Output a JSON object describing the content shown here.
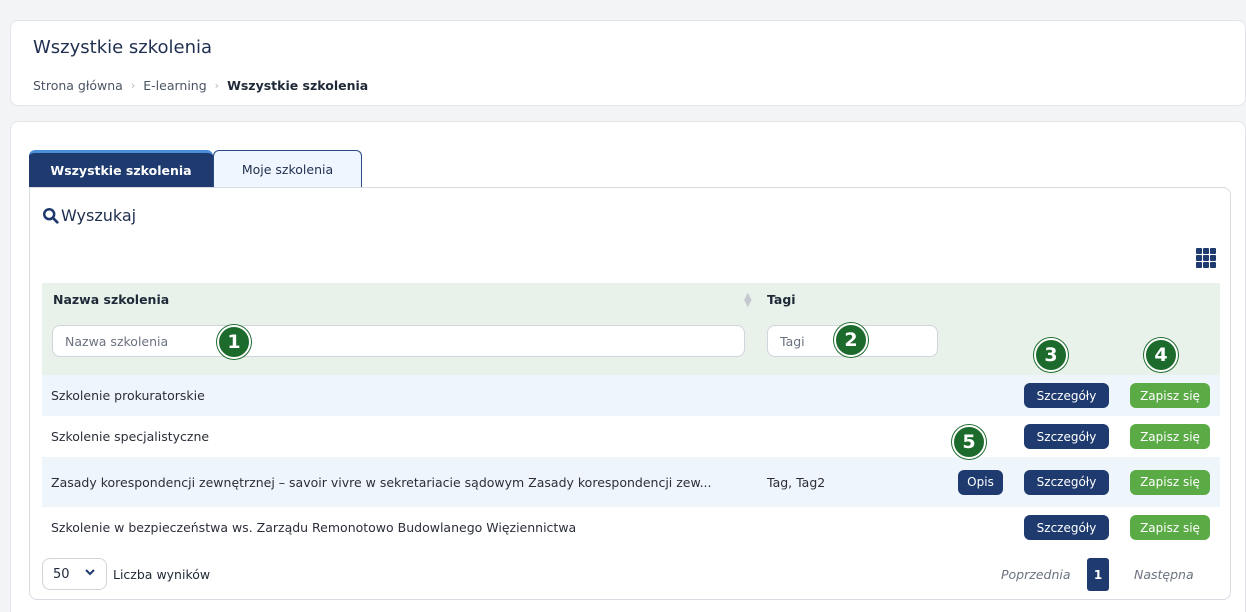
{
  "header": {
    "title": "Wszystkie szkolenia",
    "breadcrumb": {
      "home": "Strona główna",
      "section": "E-learning",
      "current": "Wszystkie szkolenia",
      "separator": "›"
    }
  },
  "tabs": [
    {
      "label": "Wszystkie szkolenia",
      "active": true
    },
    {
      "label": "Moje szkolenia",
      "active": false
    }
  ],
  "search": {
    "label": "Wyszukaj",
    "icon": "search-icon"
  },
  "columns_icon": "grid-icon",
  "table": {
    "columns": {
      "name": "Nazwa szkolenia",
      "tags": "Tagi"
    },
    "filters": {
      "name_placeholder": "Nazwa szkolenia",
      "tags_placeholder": "Tagi"
    },
    "rows": [
      {
        "name": "Szkolenie prokuratorskie",
        "tags": "",
        "opis": "",
        "details": "Szczegóły",
        "enroll": "Zapisz się"
      },
      {
        "name": "Szkolenie specjalistyczne",
        "tags": "",
        "opis": "",
        "details": "Szczegóły",
        "enroll": "Zapisz się"
      },
      {
        "name": "Zasady korespondencji zewnętrznej – savoir vivre w sekretariacie sądowym Zasady korespondencji zew...",
        "tags": "Tag, Tag2",
        "opis": "Opis",
        "details": "Szczegóły",
        "enroll": "Zapisz się"
      },
      {
        "name": "Szkolenie w bezpieczeństwa ws. Zarządu Remonotowo Budowlanego Więziennictwa",
        "tags": "",
        "opis": "",
        "details": "Szczegóły",
        "enroll": "Zapisz się"
      }
    ]
  },
  "annotations": [
    "1",
    "2",
    "3",
    "4",
    "5"
  ],
  "pagination": {
    "page_size": "50",
    "page_size_label": "Liczba wyników",
    "prev": "Poprzednia",
    "current": "1",
    "next": "Następna"
  },
  "colors": {
    "primary": "#1e3a6e",
    "success": "#5aaa45",
    "annotation": "#1d6b2c",
    "header_row": "#e8f2ea",
    "alt_row": "#eef5fb"
  }
}
